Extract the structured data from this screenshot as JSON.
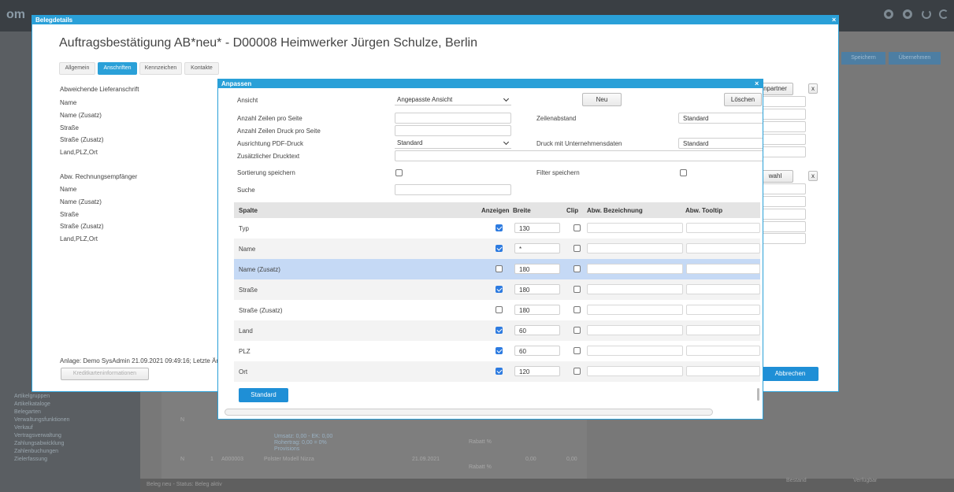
{
  "background": {
    "logo_text": "om",
    "left_nav": [
      "Artikelgruppen",
      "Artikelkataloge",
      "Belegarten",
      "Verwaltungsfunktionen",
      "Verkauf",
      "Vertragsverwaltung",
      "Zahlungsabwicklung",
      "Zahlenbuchungen",
      "Zielerfassung"
    ],
    "status_left": "Beleg neu - Status: Beleg aktiv",
    "status_right_1": "Bestand",
    "status_right_2": "Verfügbar",
    "btn_1": "Speichern",
    "btn_2": "Übernehmen",
    "row1_qty": "N",
    "row2_qty": "N",
    "row2_no": "A000003",
    "row2_pos": "1",
    "row2_name": "Polster Modell Nizza",
    "row2_date": "21.09.2021",
    "row2_val1": "0,00",
    "row2_val2": "0,00",
    "rabatt": "Rabatt %",
    "umsatz_line1": "Umsatz: 0,00 - EK: 0,00",
    "umsatz_line2": "Rohertrag: 0,00 = 0%",
    "umsatz_line3": "Provisions"
  },
  "belegdetails": {
    "window_title": "Belegdetails",
    "heading": "Auftragsbestätigung AB*neu* - D00008 Heimwerker Jürgen Schulze, Berlin",
    "tabs": [
      "Allgemein",
      "Anschriften",
      "Kennzeichen",
      "Kontakte"
    ],
    "active_tab": 1,
    "section1_title": "Abweichende Lieferanschrift",
    "section1_fields": [
      "Name",
      "Name (Zusatz)",
      "Straße",
      "Straße (Zusatz)",
      "Land,PLZ,Ort"
    ],
    "section2_title": "Abw. Rechnungsempfänger",
    "section2_fields": [
      "Name",
      "Name (Zusatz)",
      "Straße",
      "Straße (Zusatz)",
      "Land,PLZ,Ort"
    ],
    "right_btn1": "npartner",
    "right_btn2": "wahl",
    "x_label": "x",
    "anlage": "Anlage: Demo SysAdmin 21.09.2021 09:49:16; Letzte Änder",
    "kredit_btn": "Kreditkarteninformationen",
    "abbrechen_btn": "Abbrechen"
  },
  "anpassen": {
    "title": "Anpassen",
    "ansicht_label": "Ansicht",
    "ansicht_value": "Angepasste Ansicht",
    "neu_btn": "Neu",
    "loeschen_btn": "Löschen",
    "zeilen_seite_label": "Anzahl Zeilen pro Seite",
    "zeilen_druck_label": "Anzahl Zeilen Druck pro Seite",
    "ausrichtung_label": "Ausrichtung PDF-Druck",
    "ausrichtung_value": "Standard",
    "drucktext_label": "Zusätzlicher Drucktext",
    "zeilenabstand_label": "Zeilenabstand",
    "zeilenabstand_value": "Standard",
    "druck_unternehmen_label": "Druck mit Unternehmensdaten",
    "druck_unternehmen_value": "Standard",
    "sortierung_label": "Sortierung speichern",
    "filter_label": "Filter speichern",
    "suche_label": "Suche",
    "columns": {
      "spalte": "Spalte",
      "anzeigen": "Anzeigen",
      "breite": "Breite",
      "clip": "Clip",
      "bezeichnung": "Abw. Bezeichnung",
      "tooltip": "Abw. Tooltip"
    },
    "rows": [
      {
        "name": "Typ",
        "show": true,
        "width": "130",
        "clip": false
      },
      {
        "name": "Name",
        "show": true,
        "width": "*",
        "clip": false
      },
      {
        "name": "Name (Zusatz)",
        "show": false,
        "width": "180",
        "clip": false
      },
      {
        "name": "Straße",
        "show": true,
        "width": "180",
        "clip": false
      },
      {
        "name": "Straße (Zusatz)",
        "show": false,
        "width": "180",
        "clip": false
      },
      {
        "name": "Land",
        "show": true,
        "width": "60",
        "clip": false
      },
      {
        "name": "PLZ",
        "show": true,
        "width": "60",
        "clip": false
      },
      {
        "name": "Ort",
        "show": true,
        "width": "120",
        "clip": false
      }
    ],
    "standard_btn": "Standard"
  },
  "colors": {
    "titlebar": "#2aa0d8",
    "tab_active": "#2aa0d8",
    "button_blue": "#1f8fd6",
    "row_selected": "#c5d9f5",
    "row_alt": "#f3f3f3",
    "header_row": "#e4e4e4"
  }
}
